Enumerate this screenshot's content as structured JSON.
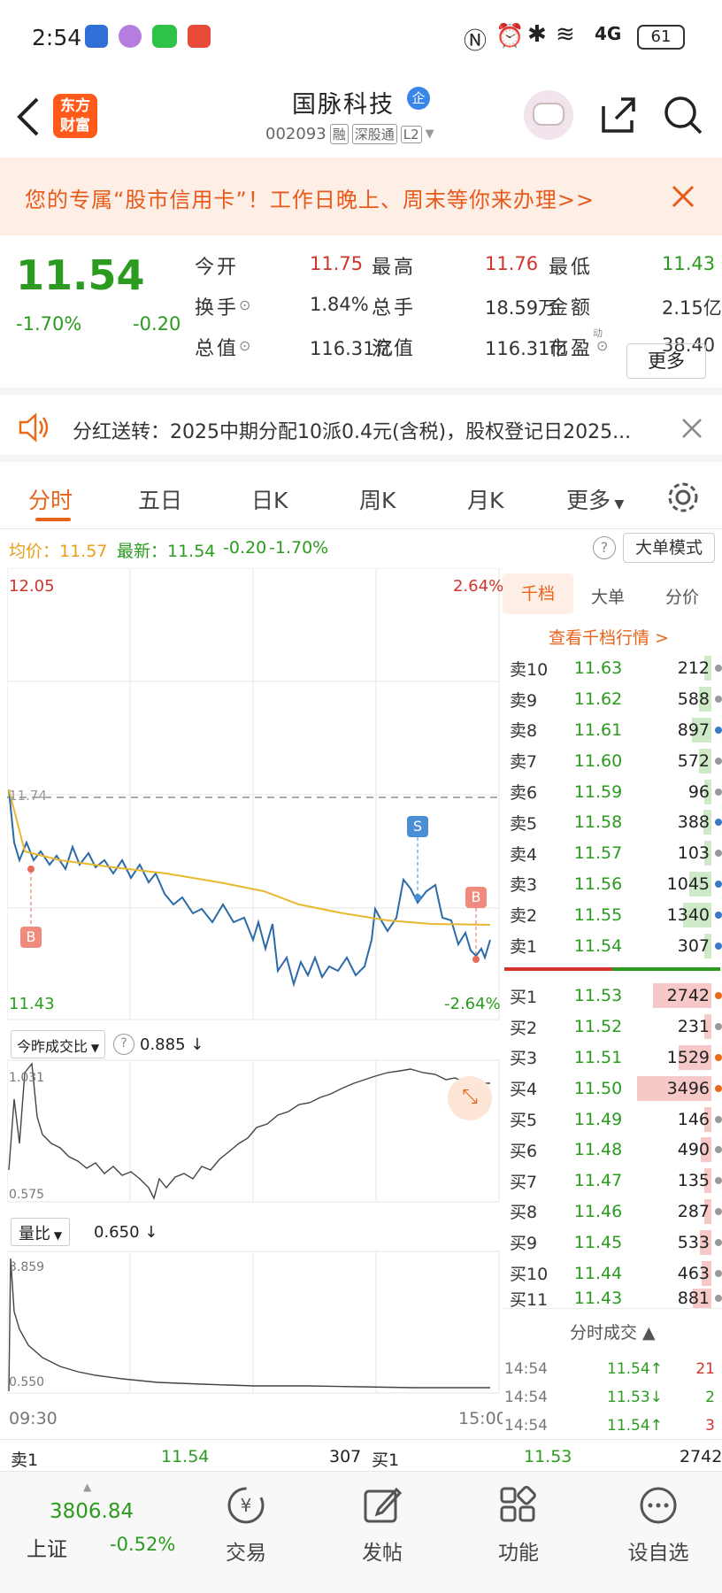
{
  "status": {
    "time": "2:54",
    "battery": "61",
    "network": "4G"
  },
  "header": {
    "logo": "东方\n财富",
    "title": "国脉科技",
    "badge": "企",
    "code": "002093",
    "tags": [
      "融",
      "深股通",
      "L2"
    ]
  },
  "banner": {
    "text": "您的专属“股市信用卡”！工作日晚上、周末等你来办理>>"
  },
  "quote": {
    "price": "11.54",
    "chg_pct": "-1.70%",
    "chg": "-0.20",
    "fields": [
      {
        "label": "今开",
        "value": "11.75",
        "color": "#d0342c"
      },
      {
        "label": "最高",
        "value": "11.76",
        "color": "#d0342c"
      },
      {
        "label": "最低",
        "value": "11.43",
        "color": "#2a9b1e"
      },
      {
        "label": "换手",
        "value": "1.84%",
        "color": "#333"
      },
      {
        "label": "总手",
        "value": "18.59万",
        "color": "#333"
      },
      {
        "label": "金额",
        "value": "2.15亿",
        "color": "#333"
      },
      {
        "label": "总值",
        "value": "116.31亿",
        "color": "#333"
      },
      {
        "label": "流值",
        "value": "116.31亿",
        "color": "#333"
      },
      {
        "label": "市盈",
        "value": "38.40",
        "color": "#333"
      }
    ],
    "pe_sup": "动",
    "more": "更多"
  },
  "notice": {
    "text": "分红送转：2025中期分配10派0.4元(含税)，股权登记日2025..."
  },
  "tabs": [
    "分时",
    "五日",
    "日K",
    "周K",
    "月K",
    "更多"
  ],
  "infobar": {
    "avg": "均价：11.57",
    "latest": "最新：11.54",
    "chg": "-0.20",
    "pct": "-1.70%",
    "mode": "大单模式"
  },
  "chart": {
    "ymax": "12.05",
    "ymin": "11.43",
    "pmax": "2.64%",
    "pmin": "-2.64%",
    "ref": "11.74",
    "b1": "B",
    "s1": "S",
    "b2": "B",
    "ind1_label": "今昨成交比",
    "ind1_val": "0.885 ↓",
    "ind1_max": "1.031",
    "ind1_min": "0.575",
    "ind2_label": "量比",
    "ind2_val": "0.650 ↓",
    "ind2_max": "3.859",
    "ind2_min": "0.550",
    "t_start": "09:30",
    "t_end": "15:00"
  },
  "side": {
    "tabs": [
      "千档",
      "大单",
      "分价"
    ],
    "link": "查看千档行情 >",
    "asks": [
      [
        "卖10",
        "11.63",
        "212",
        "#999"
      ],
      [
        "卖9",
        "11.62",
        "588",
        "#999"
      ],
      [
        "卖8",
        "11.61",
        "897",
        "#3a78c8"
      ],
      [
        "卖7",
        "11.60",
        "572",
        "#999"
      ],
      [
        "卖6",
        "11.59",
        "96",
        "#999"
      ],
      [
        "卖5",
        "11.58",
        "388",
        "#3a78c8"
      ],
      [
        "卖4",
        "11.57",
        "103",
        "#999"
      ],
      [
        "卖3",
        "11.56",
        "1045",
        "#3a78c8"
      ],
      [
        "卖2",
        "11.55",
        "1340",
        "#3a78c8"
      ],
      [
        "卖1",
        "11.54",
        "307",
        "#3a78c8"
      ]
    ],
    "bids": [
      [
        "买1",
        "11.53",
        "2742",
        "#e86a1a"
      ],
      [
        "买2",
        "11.52",
        "231",
        "#999"
      ],
      [
        "买3",
        "11.51",
        "1529",
        "#e86a1a"
      ],
      [
        "买4",
        "11.50",
        "3496",
        "#e86a1a"
      ],
      [
        "买5",
        "11.49",
        "146",
        "#999"
      ],
      [
        "买6",
        "11.48",
        "490",
        "#999"
      ],
      [
        "买7",
        "11.47",
        "135",
        "#999"
      ],
      [
        "买8",
        "11.46",
        "287",
        "#999"
      ],
      [
        "买9",
        "11.45",
        "533",
        "#999"
      ],
      [
        "买10",
        "11.44",
        "463",
        "#999"
      ],
      [
        "买11",
        "11.43",
        "881",
        "#999"
      ]
    ],
    "trades_title": "分时成交",
    "trades": [
      [
        "14:54",
        "11.54↑",
        "21"
      ],
      [
        "14:54",
        "11.53↓",
        "2"
      ],
      [
        "14:54",
        "11.54↑",
        "3"
      ]
    ]
  },
  "bottomq": {
    "s_label": "卖1",
    "s_price": "11.54",
    "s_vol": "307",
    "b_label": "买1",
    "b_price": "11.53",
    "b_vol": "2742"
  },
  "nav": {
    "index_val": "3806.84",
    "index_name": "上证",
    "index_pct": "-0.52%",
    "items": [
      "交易",
      "发帖",
      "功能",
      "设自选"
    ]
  }
}
